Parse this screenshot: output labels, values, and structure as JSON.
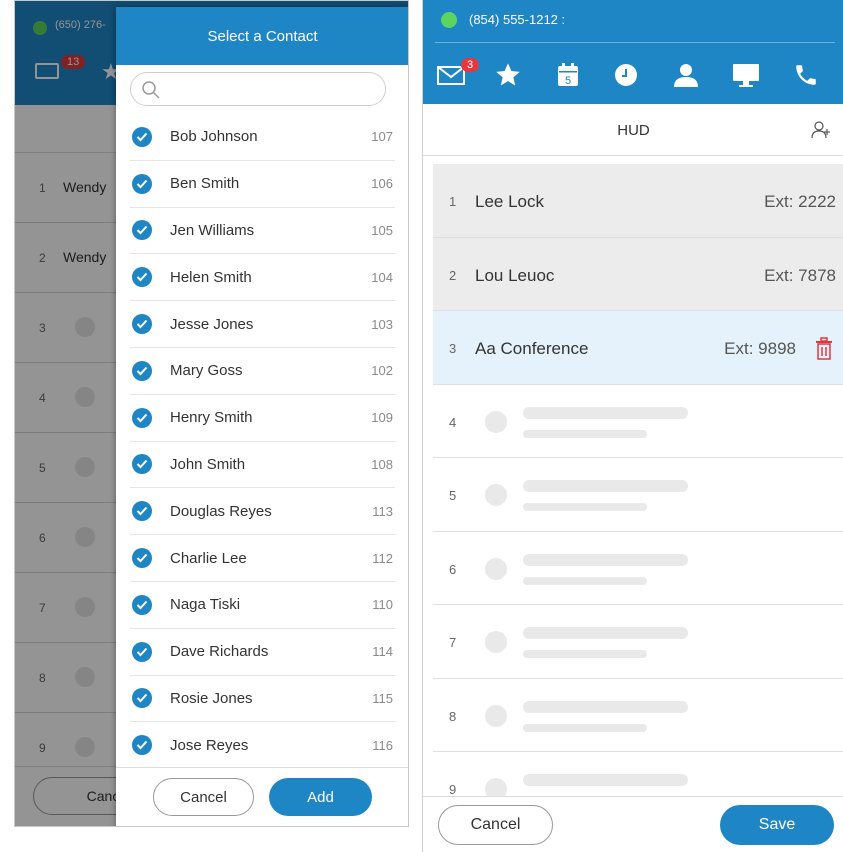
{
  "left_window": {
    "phone": "(650) 276-",
    "mail_badge": "13",
    "bg_rows": [
      {
        "num": "1",
        "name": "Wendy"
      },
      {
        "num": "2",
        "name": "Wendy"
      },
      {
        "num": "3",
        "name": ""
      },
      {
        "num": "4",
        "name": ""
      },
      {
        "num": "5",
        "name": ""
      },
      {
        "num": "6",
        "name": ""
      },
      {
        "num": "7",
        "name": ""
      },
      {
        "num": "8",
        "name": ""
      },
      {
        "num": "9",
        "name": ""
      }
    ],
    "bg_cancel_label": "Canc"
  },
  "modal": {
    "title": "Select a Contact",
    "search": {
      "value": "",
      "placeholder": ""
    },
    "contacts": [
      {
        "name": "Bob Johnson",
        "ext": "107",
        "checked": true
      },
      {
        "name": "Ben Smith",
        "ext": "106",
        "checked": true
      },
      {
        "name": "Jen Williams",
        "ext": "105",
        "checked": true
      },
      {
        "name": "Helen Smith",
        "ext": "104",
        "checked": true
      },
      {
        "name": "Jesse Jones",
        "ext": "103",
        "checked": true
      },
      {
        "name": "Mary Goss",
        "ext": "102",
        "checked": true
      },
      {
        "name": "Henry Smith",
        "ext": "109",
        "checked": true
      },
      {
        "name": "John Smith",
        "ext": "108",
        "checked": true
      },
      {
        "name": "Douglas Reyes",
        "ext": "113",
        "checked": true
      },
      {
        "name": "Charlie Lee",
        "ext": "112",
        "checked": true
      },
      {
        "name": "Naga Tiski",
        "ext": "110",
        "checked": true
      },
      {
        "name": "Dave Richards",
        "ext": "114",
        "checked": true
      },
      {
        "name": "Rosie Jones",
        "ext": "115",
        "checked": true
      },
      {
        "name": "Jose Reyes",
        "ext": "116",
        "checked": true
      }
    ],
    "cancel_label": "Cancel",
    "add_label": "Add"
  },
  "right_window": {
    "phone": "(854) 555-1212 :",
    "mail_badge": "3",
    "calendar_day": "5",
    "title": "HUD",
    "rows": [
      {
        "num": "1",
        "name": "Lee Lock",
        "ext": "Ext: 2222",
        "state": "filled"
      },
      {
        "num": "2",
        "name": "Lou Leuoc",
        "ext": "Ext: 7878",
        "state": "filled"
      },
      {
        "num": "3",
        "name": "Aa  Conference",
        "ext": "Ext: 9898",
        "state": "selected"
      },
      {
        "num": "4",
        "name": "",
        "ext": "",
        "state": "empty"
      },
      {
        "num": "5",
        "name": "",
        "ext": "",
        "state": "empty"
      },
      {
        "num": "6",
        "name": "",
        "ext": "",
        "state": "empty"
      },
      {
        "num": "7",
        "name": "",
        "ext": "",
        "state": "empty"
      },
      {
        "num": "8",
        "name": "",
        "ext": "",
        "state": "empty"
      },
      {
        "num": "9",
        "name": "",
        "ext": "",
        "state": "empty"
      }
    ],
    "cancel_label": "Cancel",
    "save_label": "Save"
  },
  "colors": {
    "brand_blue": "#1f86c6",
    "badge_red": "#e0393e",
    "status_green": "#5cd460",
    "trash_red": "#e0393e"
  }
}
